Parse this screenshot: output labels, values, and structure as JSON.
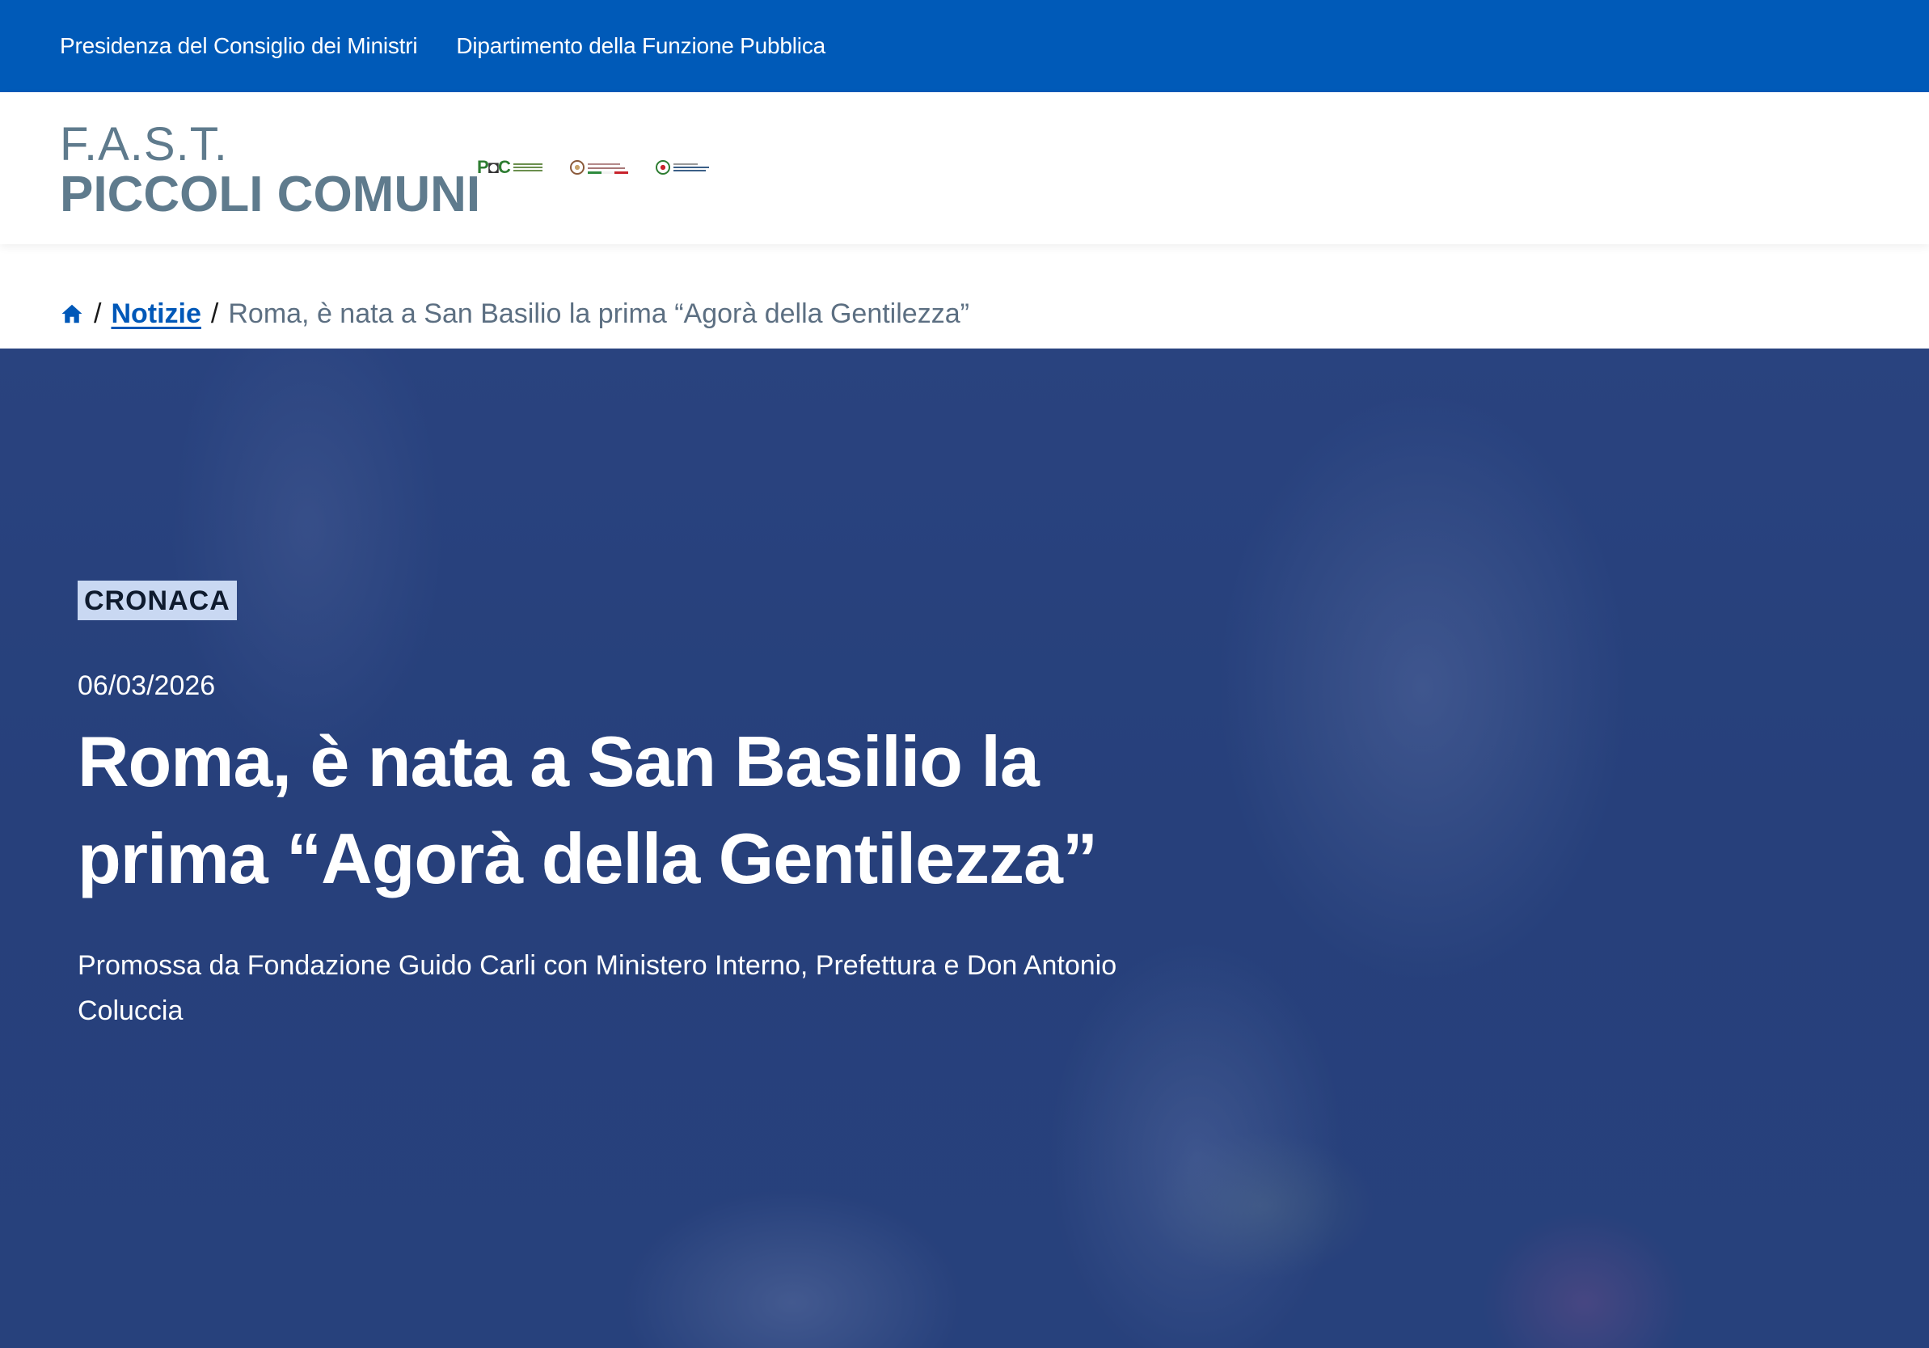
{
  "topbar": {
    "links": [
      "Presidenza del Consiglio dei Ministri",
      "Dipartimento della Funzione Pubblica"
    ]
  },
  "brand": {
    "line1": "F.A.S.T.",
    "line2": "PICCOLI COMUNI"
  },
  "logos": {
    "poc": "P C",
    "items": [
      "poc-logo",
      "agenzia-coesione-logo",
      "dipartimento-funzione-pubblica-logo"
    ]
  },
  "breadcrumb": {
    "home_icon": "home-icon",
    "separator": "/",
    "section": "Notizie",
    "current": "Roma, è nata a San Basilio la prima “Agorà della Gentilezza”"
  },
  "article": {
    "category": "CRONACA",
    "date": "06/03/2026",
    "title": "Roma, è nata a San Basilio la prima “Agorà della Gentilezza”",
    "subtitle": "Promossa da Fondazione Guido Carli con Ministero Interno, Prefettura e Don Antonio Coluccia"
  },
  "colors": {
    "topbar": "#005ab8",
    "brand": "#5f7b8d",
    "link": "#0058b8",
    "tag_bg": "#c9d8f2",
    "hero_overlay": "#2f4a86"
  }
}
